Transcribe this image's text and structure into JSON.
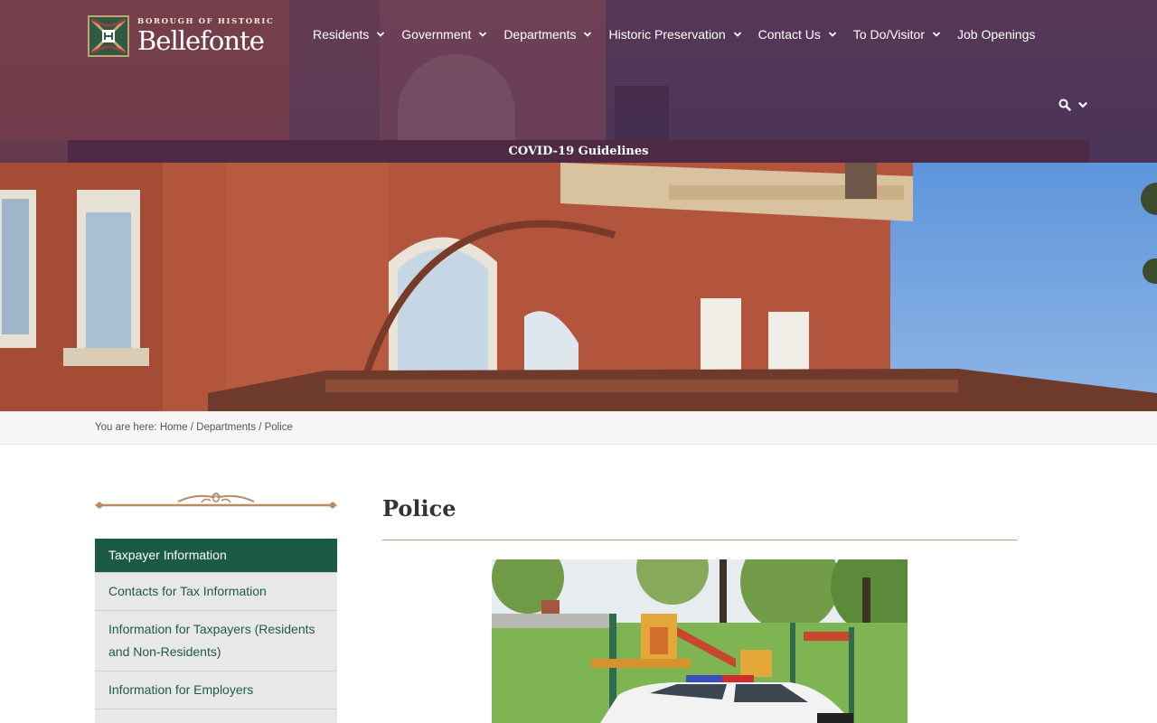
{
  "site": {
    "logo_small": "BOROUGH OF HISTORIC",
    "logo_big": "Bellefonte"
  },
  "nav": {
    "items": [
      {
        "label": "Residents",
        "has_dropdown": true
      },
      {
        "label": "Government",
        "has_dropdown": true
      },
      {
        "label": "Departments",
        "has_dropdown": true
      },
      {
        "label": "Historic Preservation",
        "has_dropdown": true
      },
      {
        "label": "Contact Us",
        "has_dropdown": true
      },
      {
        "label": "To Do/Visitor",
        "has_dropdown": true
      },
      {
        "label": "Job Openings",
        "has_dropdown": false
      }
    ],
    "search_icon": "search-icon"
  },
  "banner": {
    "label": "COVID-19 Guidelines"
  },
  "breadcrumb": {
    "prefix": "You are here:",
    "home": "Home",
    "sep": "/",
    "departments": "Departments",
    "current": "Police"
  },
  "sidebar": {
    "items": [
      {
        "label": "Taxpayer Information",
        "active": true
      },
      {
        "label": "Contacts for Tax Information",
        "active": false
      },
      {
        "label": "Information for Taxpayers (Residents and Non-Residents)",
        "active": false
      },
      {
        "label": "Information for Employers",
        "active": false
      }
    ]
  },
  "main": {
    "title": "Police"
  },
  "colors": {
    "header_bg": "#4d3658",
    "banner_bg": "#4e2a45",
    "sidebar_active": "#1b5a43",
    "sidebar_link": "#1f5b45",
    "accent_rule": "#b19a77"
  }
}
